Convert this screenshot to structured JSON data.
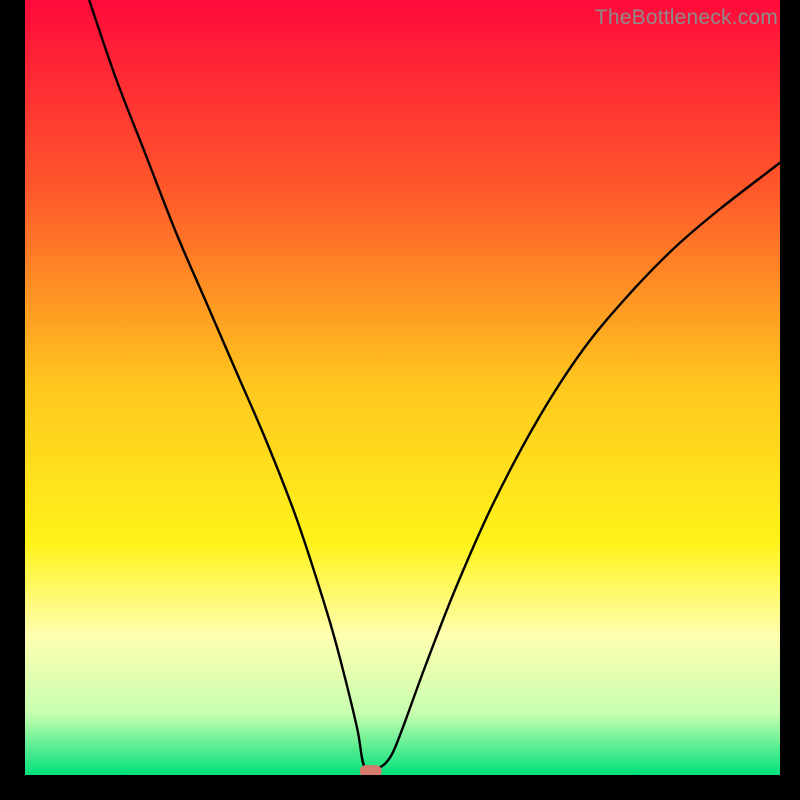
{
  "watermark": "TheBottleneck.com",
  "chart_data": {
    "type": "line",
    "title": "",
    "xlabel": "",
    "ylabel": "",
    "xlim": [
      0,
      100
    ],
    "ylim": [
      0,
      100
    ],
    "grid": false,
    "legend": false,
    "background": {
      "type": "vertical-gradient",
      "stops": [
        {
          "pos": 0.0,
          "color": "#ff0a3b"
        },
        {
          "pos": 0.25,
          "color": "#ff5a2a"
        },
        {
          "pos": 0.5,
          "color": "#ffc81e"
        },
        {
          "pos": 0.7,
          "color": "#fff31a"
        },
        {
          "pos": 0.82,
          "color": "#ffffb0"
        },
        {
          "pos": 0.92,
          "color": "#c8ffb0"
        },
        {
          "pos": 1.0,
          "color": "#00e07a"
        }
      ]
    },
    "marker": {
      "x": 45.8,
      "y": 0.5,
      "color": "#d67a6e"
    },
    "series": [
      {
        "name": "bottleneck-curve",
        "color": "#000000",
        "x": [
          8.5,
          12,
          16,
          20,
          24,
          28,
          32,
          36,
          40,
          42,
          44,
          45,
          47,
          48.5,
          50,
          53,
          57,
          62,
          68,
          74,
          80,
          86,
          92,
          100
        ],
        "values": [
          100,
          90,
          80,
          70,
          61,
          52,
          43,
          33,
          21,
          14,
          6,
          1,
          1,
          2.5,
          6,
          14,
          24,
          35,
          46,
          55,
          62,
          68,
          73,
          79
        ]
      }
    ]
  }
}
